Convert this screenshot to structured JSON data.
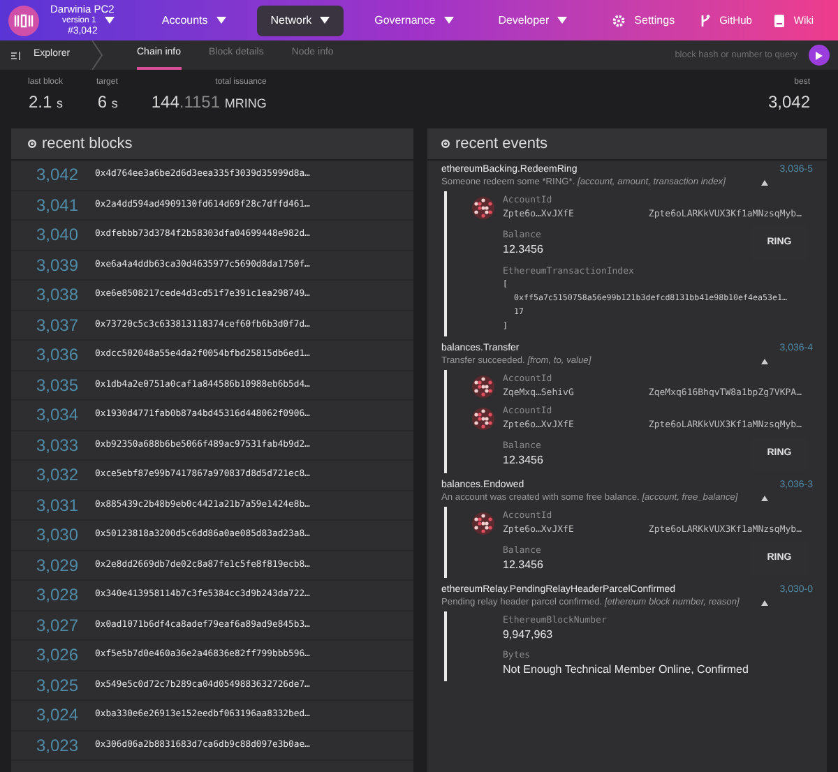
{
  "chain": {
    "name": "Darwinia PC2",
    "version": "version 1",
    "block": "#3,042"
  },
  "nav": [
    {
      "label": "Accounts",
      "kind": "menu",
      "selected": false
    },
    {
      "label": "Network",
      "kind": "menu",
      "selected": true
    },
    {
      "label": "Governance",
      "kind": "menu",
      "selected": false
    },
    {
      "label": "Developer",
      "kind": "menu",
      "selected": false
    },
    {
      "label": "Settings",
      "kind": "settings",
      "selected": false
    }
  ],
  "links": [
    {
      "label": "GitHub",
      "kind": "github"
    },
    {
      "label": "Wiki",
      "kind": "wiki"
    }
  ],
  "section": "Explorer",
  "tabs": [
    {
      "label": "Chain info",
      "selected": true
    },
    {
      "label": "Block details",
      "selected": false
    },
    {
      "label": "Node info",
      "selected": false
    }
  ],
  "search": {
    "placeholder": "block hash or number to query"
  },
  "summary": [
    {
      "label": "last block",
      "value": "2.1",
      "unit": "s"
    },
    {
      "label": "target",
      "value": "6",
      "unit": "s"
    },
    {
      "label": "total issuance",
      "value": "144",
      "decimals": ".1151",
      "unit": "MRING"
    }
  ],
  "best": {
    "label": "best",
    "value": "3,042"
  },
  "recent_blocks": {
    "title": "recent blocks",
    "rows": [
      {
        "number": "3,042",
        "hash": "0x4d764ee3a6be2d6d3eea335f3039d35999d8a…"
      },
      {
        "number": "3,041",
        "hash": "0x2a4dd594ad4909130fd614d69f28c7dffd461…"
      },
      {
        "number": "3,040",
        "hash": "0xdfebbb73d3784f2b58303dfa04699448e982d…"
      },
      {
        "number": "3,039",
        "hash": "0xe6a4a4ddb63ca30d4635977c5690d8da1750f…"
      },
      {
        "number": "3,038",
        "hash": "0xe6e8508217cede4d3cd51f7e391c1ea298749…"
      },
      {
        "number": "3,037",
        "hash": "0x73720c5c3c633813118374cef60fb6b3d0f7d…"
      },
      {
        "number": "3,036",
        "hash": "0xdcc502048a55e4da2f0054bfbd25815db6ed1…"
      },
      {
        "number": "3,035",
        "hash": "0x1db4a2e0751a0caf1a844586b10988eb6b5d4…"
      },
      {
        "number": "3,034",
        "hash": "0x1930d4771fab0b87a4bd45316d448062f0906…"
      },
      {
        "number": "3,033",
        "hash": "0xb92350a688b6be5066f489ac97531fab4b9d2…"
      },
      {
        "number": "3,032",
        "hash": "0xce5ebf87e99b7417867a970837d8d5d721ec8…"
      },
      {
        "number": "3,031",
        "hash": "0x885439c2b48b9eb0c4421a21b7a59e1424e8b…"
      },
      {
        "number": "3,030",
        "hash": "0x50123818a3200d5c6dd86a0ae085d83ad23a8…"
      },
      {
        "number": "3,029",
        "hash": "0x2e8dd2669db7de02c8a87fe1c5fe8f819ecb8…"
      },
      {
        "number": "3,028",
        "hash": "0x340e413958114b7c3fe5384cc3d9b243da722…"
      },
      {
        "number": "3,027",
        "hash": "0x0ad1071b6df4ca8adef79eaf6a89ad9e845b3…"
      },
      {
        "number": "3,026",
        "hash": "0xf5e5b7d0e460a36e2a46836e82ff799bbb596…"
      },
      {
        "number": "3,025",
        "hash": "0x549e5c0d72c7b289ca04d0549883632726de7…"
      },
      {
        "number": "3,024",
        "hash": "0xba330e6e26913e152eedbf063196aa8332bed…"
      },
      {
        "number": "3,023",
        "hash": "0x306d06a2b8831683d7ca6db9c88d097e3b0ae…"
      }
    ]
  },
  "recent_events": {
    "title": "recent events",
    "events": [
      {
        "name": "ethereumBacking.RedeemRing",
        "description": "Someone redeem some *RING*.",
        "args": "[account, amount, transaction index]",
        "id": "3,036-5",
        "expanded": true,
        "params": [
          {
            "kind": "account",
            "label": "AccountId",
            "short": "Zpte6o…XvJXfE",
            "full": "Zpte6oLARKkVUX3Kf1aMNzsqMyb…"
          },
          {
            "kind": "balance",
            "label": "Balance",
            "value": "12.3456",
            "unit": "RING"
          },
          {
            "kind": "array",
            "label": "EthereumTransactionIndex",
            "lines": [
              "[",
              "0xff5a7c5150758a56e99b121b3defcd8131bb41e98b10ef4ea53e1…",
              "17",
              "]"
            ]
          }
        ]
      },
      {
        "name": "balances.Transfer",
        "description": "Transfer succeeded.",
        "args": "[from, to, value]",
        "id": "3,036-4",
        "expanded": true,
        "params": [
          {
            "kind": "account",
            "label": "AccountId",
            "short": "ZqeMxq…SehivG",
            "full": "ZqeMxq616BhqvTW8a1bpZg7VKPA…"
          },
          {
            "kind": "account",
            "label": "AccountId",
            "short": "Zpte6o…XvJXfE",
            "full": "Zpte6oLARKkVUX3Kf1aMNzsqMyb…"
          },
          {
            "kind": "balance",
            "label": "Balance",
            "value": "12.3456",
            "unit": "RING"
          }
        ]
      },
      {
        "name": "balances.Endowed",
        "description": "An account was created with some free balance.",
        "args": "[account, free_balance]",
        "id": "3,036-3",
        "expanded": true,
        "params": [
          {
            "kind": "account",
            "label": "AccountId",
            "short": "Zpte6o…XvJXfE",
            "full": "Zpte6oLARKkVUX3Kf1aMNzsqMyb…"
          },
          {
            "kind": "balance",
            "label": "Balance",
            "value": "12.3456",
            "unit": "RING"
          }
        ]
      },
      {
        "name": "ethereumRelay.PendingRelayHeaderParcelConfirmed",
        "description": "Pending relay header parcel confirmed.",
        "args": "[ethereum block number, reason]",
        "id": "3,030-0",
        "expanded": true,
        "params": [
          {
            "kind": "number",
            "label": "EthereumBlockNumber",
            "value": "9,947,963"
          },
          {
            "kind": "text",
            "label": "Bytes",
            "value": "Not Enough Technical Member Online, Confirmed"
          }
        ]
      }
    ]
  }
}
